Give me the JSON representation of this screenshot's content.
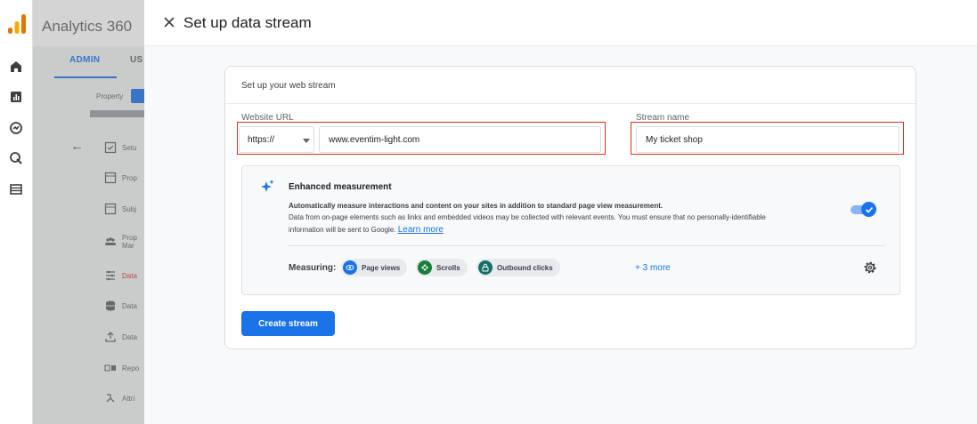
{
  "app": {
    "title": "Analytics 360"
  },
  "colors": {
    "accent": "#1a73e8",
    "highlight": "#d93025",
    "toggle_track": "#8ab4f8"
  },
  "background_panel": {
    "tabs": [
      "ADMIN",
      "US"
    ],
    "property_label": "Property",
    "items": [
      {
        "icon": "checkbox-icon",
        "label": "Setu"
      },
      {
        "icon": "square-icon",
        "label": "Prop"
      },
      {
        "icon": "square-icon",
        "label": "Subj"
      },
      {
        "icon": "people-icon",
        "label": "Prop\nMar"
      },
      {
        "icon": "data-streams-icon",
        "label": "Data",
        "active": true
      },
      {
        "icon": "database-icon",
        "label": "Data"
      },
      {
        "icon": "upload-icon",
        "label": "Data"
      },
      {
        "icon": "reporting-icon",
        "label": "Repo"
      },
      {
        "icon": "attribution-icon",
        "label": "Attri"
      }
    ]
  },
  "dialog": {
    "title": "Set up data stream",
    "card_title": "Set up your web stream",
    "website_url": {
      "label": "Website URL",
      "protocol": "https://",
      "value": "www.eventim-light.com"
    },
    "stream_name": {
      "label": "Stream name",
      "value": "My ticket shop"
    },
    "enhanced": {
      "title": "Enhanced measurement",
      "line1": "Automatically measure interactions and content on your sites in addition to standard page view measurement.",
      "line2": "Data from on-page elements such as links and embedded videos may be collected with relevant events. You must ensure that no personally-identifiable",
      "line3": "information will be sent to Google.",
      "learn_more": "Learn more",
      "enabled": true,
      "measuring_label": "Measuring:",
      "chips": [
        {
          "label": "Page views",
          "color": "#1a73e8",
          "icon": "eye-icon"
        },
        {
          "label": "Scrolls",
          "color": "#188038",
          "icon": "scroll-icon"
        },
        {
          "label": "Outbound clicks",
          "color": "#12706b",
          "icon": "lock-icon"
        }
      ],
      "more_label": "+ 3 more"
    },
    "create_button": "Create stream"
  }
}
